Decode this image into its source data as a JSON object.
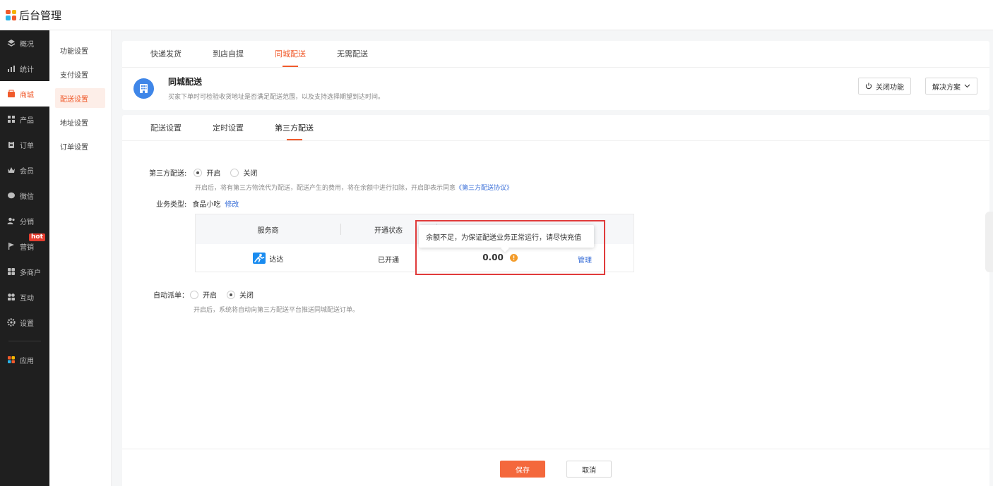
{
  "app": {
    "title": "后台管理"
  },
  "sidenav": {
    "items": [
      {
        "label": "概况",
        "icon": "layers-icon"
      },
      {
        "label": "统计",
        "icon": "stats-icon"
      },
      {
        "label": "商城",
        "icon": "shop-icon",
        "active": true
      },
      {
        "label": "产品",
        "icon": "grid-icon"
      },
      {
        "label": "订单",
        "icon": "clipboard-icon"
      },
      {
        "label": "会员",
        "icon": "crown-icon"
      },
      {
        "label": "微信",
        "icon": "wechat-icon"
      },
      {
        "label": "分销",
        "icon": "users-icon"
      },
      {
        "label": "营销",
        "icon": "flag-icon",
        "badge": "hot"
      },
      {
        "label": "多商户",
        "icon": "stores-icon"
      },
      {
        "label": "互动",
        "icon": "interact-icon"
      },
      {
        "label": "设置",
        "icon": "gear-icon"
      },
      {
        "label": "应用",
        "icon": "apps-icon"
      }
    ]
  },
  "submenu": {
    "items": [
      "功能设置",
      "支付设置",
      "配送设置",
      "地址设置",
      "订单设置"
    ]
  },
  "top_tabs": [
    "快递发货",
    "到店自提",
    "同城配送",
    "无需配送"
  ],
  "header": {
    "title": "同城配送",
    "desc": "买家下单时可检验收货地址是否满足配送范围，以及支持选择期望到达时间。",
    "close_btn": "关闭功能",
    "solution_btn": "解决方案"
  },
  "sub_tabs": [
    "配送设置",
    "定时设置",
    "第三方配送"
  ],
  "form": {
    "third_party_label": "第三方配送:",
    "on_label": "开启",
    "off_label": "关闭",
    "third_party_hint": "开启后，将有第三方物流代为配送，配送产生的费用，将在余额中进行扣除，开启即表示同意",
    "agreement_link": "《第三方配送协议》",
    "biz_type_label": "业务类型:",
    "biz_type_value": "食品小吃",
    "biz_type_edit": "修改",
    "auto_dispatch_label": "自动派单：",
    "auto_dispatch_hint": "开启后，系统将自动向第三方配送平台推送同城配送订单。"
  },
  "table": {
    "headers": [
      "服务商",
      "开通状态"
    ],
    "row": {
      "provider": "达达",
      "status": "已开通",
      "balance": "0.00",
      "action": "管理"
    }
  },
  "tooltip": {
    "text": "余额不足，为保证配送业务正常运行，请尽快充值"
  },
  "footer": {
    "save": "保存",
    "cancel": "取消"
  },
  "colors": {
    "accent": "#f05a2b",
    "link": "#3a6fd8",
    "primary_btn": "#f4683c",
    "warning": "#f39c2b",
    "dada_blue": "#1a8cf0"
  }
}
